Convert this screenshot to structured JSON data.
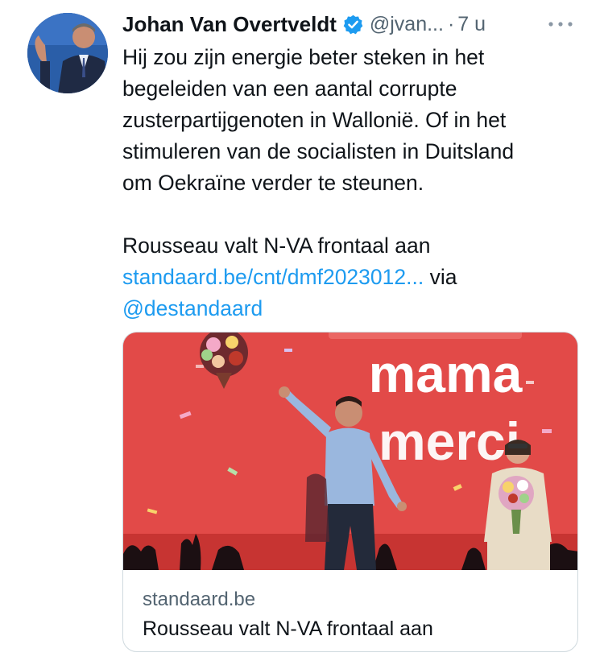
{
  "tweet": {
    "author_name": "Johan Van Overtveldt",
    "handle": "@jvan...",
    "dot": "·",
    "time": "7 u",
    "text_lines": [
      "Hij zou zijn energie beter steken in het",
      "begeleiden van een aantal corrupte",
      "zusterpartijgenoten in Wallonië. Of in het",
      "stimuleren van de socialisten in Duitsland",
      "om Oekraïne verder te steunen."
    ],
    "headline": "Rousseau valt N-VA frontaal aan",
    "link_text": "standaard.be/cnt/dmf2023012...",
    "via": "via",
    "mention": "@destandaard"
  },
  "card": {
    "image_text_line1": "mama",
    "image_text_line2": "merci",
    "domain": "standaard.be",
    "title": "Rousseau valt N-VA frontaal aan"
  },
  "icons": {
    "verified": "verified-badge-icon",
    "more": "more-options-icon"
  },
  "colors": {
    "link": "#1d9bf0",
    "verified": "#1d9bf0",
    "card_background": "#e24a48",
    "muted_text": "#536471"
  }
}
